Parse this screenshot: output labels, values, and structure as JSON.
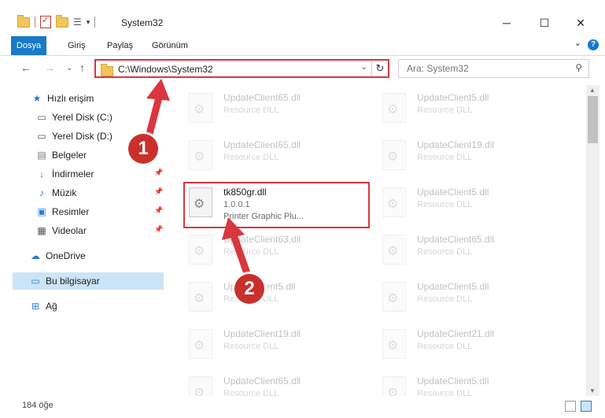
{
  "window": {
    "title": "System32",
    "minimize": "─",
    "maximize": "☐",
    "close": "✕"
  },
  "ribbon": {
    "tabs": [
      "Dosya",
      "Giriş",
      "Paylaş",
      "Görünüm"
    ],
    "help": "?",
    "chevron": "⌄"
  },
  "nav": {
    "back": "←",
    "forward": "→",
    "recent": "⌄",
    "up": "↑",
    "address": "C:\\Windows\\System32",
    "search_placeholder": "Ara: System32"
  },
  "sidebar": {
    "items": [
      {
        "label": "Hızlı erişim",
        "icon": "star-icon"
      },
      {
        "label": "Yerel Disk (C:)",
        "icon": "drive-icon"
      },
      {
        "label": "Yerel Disk (D:)",
        "icon": "drive-icon"
      },
      {
        "label": "Belgeler",
        "icon": "documents-icon"
      },
      {
        "label": "İndirmeler",
        "icon": "download-icon"
      },
      {
        "label": "Müzik",
        "icon": "music-icon"
      },
      {
        "label": "Resimler",
        "icon": "pictures-icon"
      },
      {
        "label": "Videolar",
        "icon": "video-icon"
      },
      {
        "label": "OneDrive",
        "icon": "cloud-icon"
      },
      {
        "label": "Bu bilgisayar",
        "icon": "computer-icon"
      },
      {
        "label": "Ağ",
        "icon": "network-icon"
      }
    ]
  },
  "files": {
    "left": [
      {
        "name": "UpdateClient65.dll",
        "desc": "Resource DLL"
      },
      {
        "name": "UpdateClient65.dll",
        "desc": "Resource DLL"
      },
      {
        "name": "tk850gr.dll",
        "version": "1.0.0.1",
        "desc": "Printer Graphic Plu..."
      },
      {
        "name": "UpdateClient63.dll",
        "desc": "Resource DLL"
      },
      {
        "name": "UpdateClient5.dll",
        "desc": "Resource DLL"
      },
      {
        "name": "UpdateClient19.dll",
        "desc": "Resource DLL"
      },
      {
        "name": "UpdateClient65.dll",
        "desc": "Resource DLL"
      }
    ],
    "right": [
      {
        "name": "UpdateClient5.dll",
        "desc": "Resource DLL"
      },
      {
        "name": "UpdateClient19.dll",
        "desc": "Resource DLL"
      },
      {
        "name": "UpdateClient5.dll",
        "desc": "Resource DLL"
      },
      {
        "name": "UpdateClient65.dll",
        "desc": "Resource DLL"
      },
      {
        "name": "UpdateClient5.dll",
        "desc": "Resource DLL"
      },
      {
        "name": "UpdateClient21.dll",
        "desc": "Resource DLL"
      },
      {
        "name": "UpdateClient5.dll",
        "desc": "Resource DLL"
      }
    ]
  },
  "status": {
    "count": "184 öğe"
  },
  "annotations": {
    "badge1": "1",
    "badge2": "2",
    "color": "#d9363e"
  }
}
